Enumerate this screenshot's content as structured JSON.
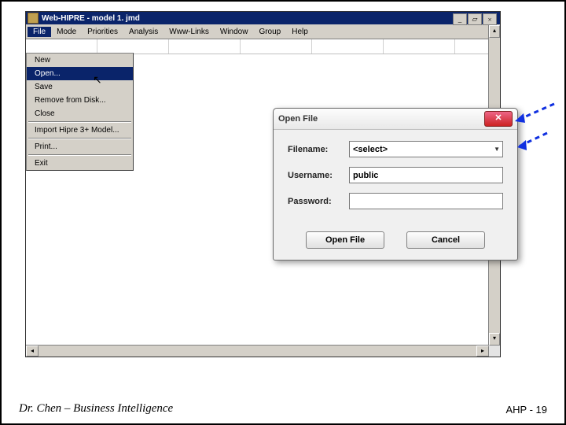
{
  "window": {
    "title": "Web-HIPRE - model 1. jmd",
    "minimize": "_",
    "restore": "▱",
    "close": "×"
  },
  "menubar": [
    "File",
    "Mode",
    "Priorities",
    "Analysis",
    "Www-Links",
    "Window",
    "Group",
    "Help"
  ],
  "file_menu": {
    "items": [
      "New",
      "Open...",
      "Save",
      "Remove from Disk...",
      "Close",
      "Import Hipre 3+ Model...",
      "Print...",
      "Exit"
    ],
    "selected_index": 1
  },
  "dialog": {
    "title": "Open File",
    "close_label": "✕",
    "fields": {
      "filename_label": "Filename:",
      "filename_value": "<select>",
      "username_label": "Username:",
      "username_value": "public",
      "password_label": "Password:",
      "password_value": ""
    },
    "buttons": {
      "ok": "Open File",
      "cancel": "Cancel"
    }
  },
  "footer": {
    "left": "Dr. Chen – Business Intelligence",
    "right": "AHP - 19"
  }
}
